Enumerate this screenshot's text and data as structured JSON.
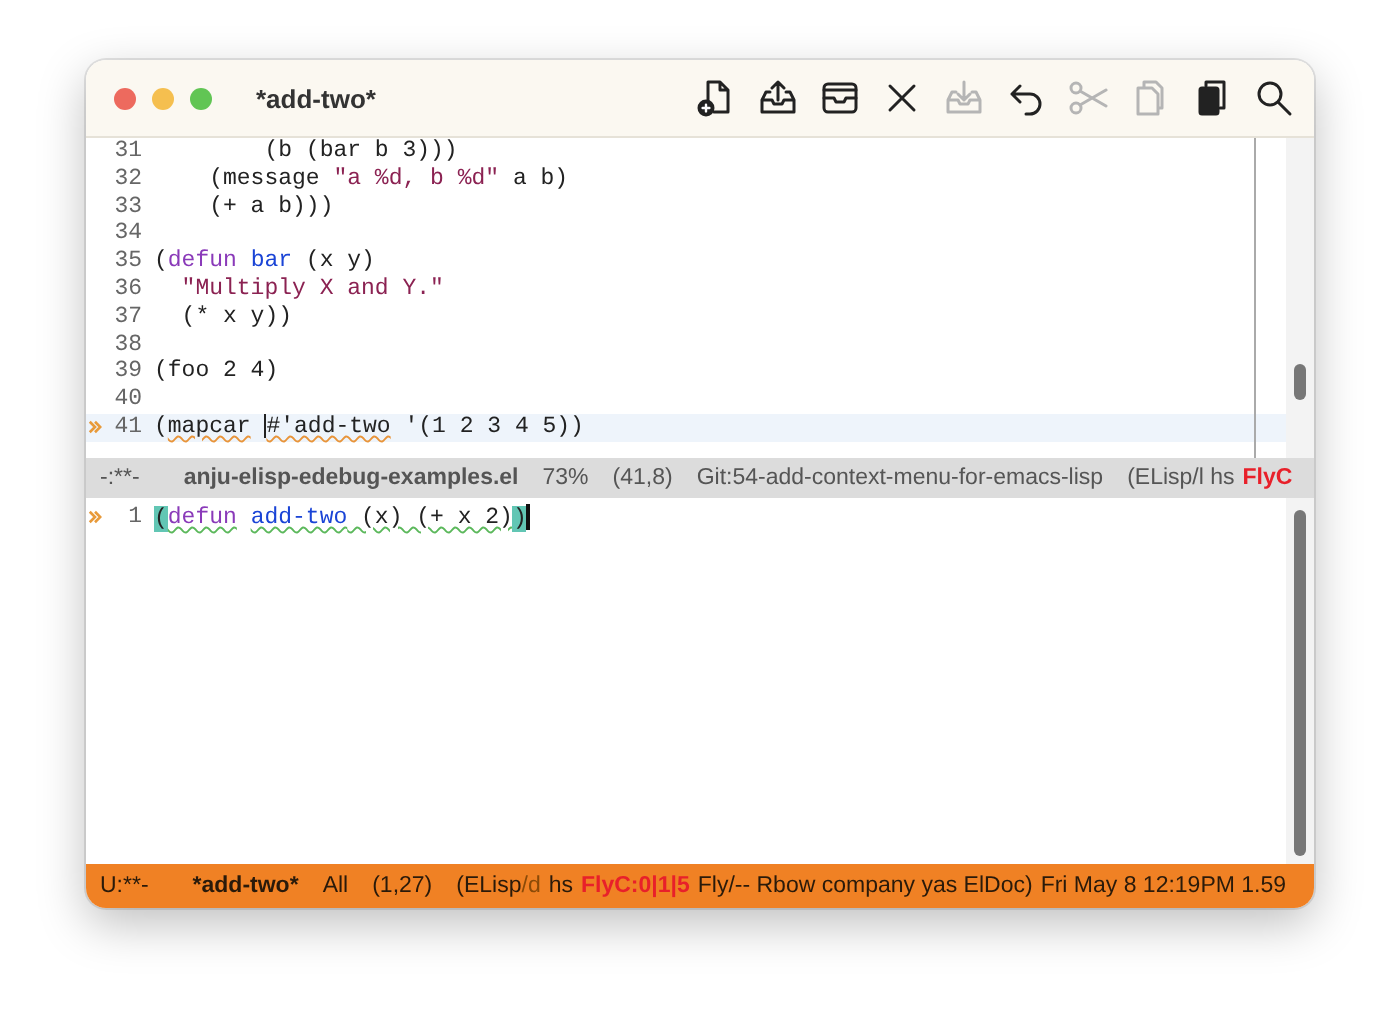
{
  "window": {
    "title": "*add-two*"
  },
  "toolbar": [
    {
      "kind": "new-file",
      "disabled": false
    },
    {
      "kind": "upload",
      "disabled": false
    },
    {
      "kind": "tray",
      "disabled": false
    },
    {
      "kind": "close",
      "disabled": false
    },
    {
      "kind": "download",
      "disabled": true
    },
    {
      "kind": "undo",
      "disabled": false
    },
    {
      "kind": "scissors",
      "disabled": true
    },
    {
      "kind": "copy",
      "disabled": true
    },
    {
      "kind": "paste",
      "disabled": false
    },
    {
      "kind": "search",
      "disabled": false
    }
  ],
  "panes": [
    {
      "active": false,
      "lines": [
        {
          "number": "31",
          "arrow": false,
          "highlighted": false,
          "segments": [
            {
              "kind": "plain",
              "text": "        (b (bar b 3)))"
            }
          ]
        },
        {
          "number": "32",
          "arrow": false,
          "highlighted": false,
          "segments": [
            {
              "kind": "plain",
              "text": "    (message "
            },
            {
              "kind": "string",
              "text": "\"a %d, b %d\""
            },
            {
              "kind": "plain",
              "text": " a b)"
            }
          ]
        },
        {
          "number": "33",
          "arrow": false,
          "highlighted": false,
          "segments": [
            {
              "kind": "plain",
              "text": "    (+ a b)))"
            }
          ]
        },
        {
          "number": "34",
          "arrow": false,
          "highlighted": false
        },
        {
          "number": "35",
          "arrow": false,
          "highlighted": false,
          "segments": [
            {
              "kind": "plain",
              "text": "("
            },
            {
              "kind": "keyword",
              "text": "defun"
            },
            {
              "kind": "space"
            },
            {
              "kind": "function",
              "text": "bar"
            },
            {
              "kind": "plain",
              "text": " (x y)"
            }
          ]
        },
        {
          "number": "36",
          "arrow": false,
          "highlighted": false,
          "segments": [
            {
              "kind": "string",
              "text": "  \"Multiply X and Y.\""
            }
          ]
        },
        {
          "number": "37",
          "arrow": false,
          "highlighted": false,
          "segments": [
            {
              "kind": "plain",
              "text": "  (* x y))"
            }
          ]
        },
        {
          "number": "38",
          "arrow": false,
          "highlighted": false
        },
        {
          "number": "39",
          "arrow": false,
          "highlighted": false,
          "segments": [
            {
              "kind": "plain",
              "text": "(foo 2 4)"
            }
          ]
        },
        {
          "number": "40",
          "arrow": false,
          "highlighted": false
        },
        {
          "number": "41",
          "arrow": true,
          "highlighted": true,
          "segments": [
            {
              "kind": "plain",
              "text": "("
            },
            {
              "kind": "warning",
              "text": "mapcar"
            },
            {
              "kind": "space"
            },
            {
              "kind": "cursor"
            },
            {
              "kind": "warning",
              "text": "#'add-two"
            },
            {
              "kind": "plain",
              "text": " '(1 2 3 4 5))"
            }
          ]
        }
      ],
      "mode_line": [
        {
          "kind": "plain",
          "text": "-:**-"
        },
        {
          "kind": "bold",
          "text": "anju-elisp-edebug-examples.el"
        },
        {
          "kind": "plain",
          "text": "73%"
        },
        {
          "kind": "plain",
          "text": "(41,8)"
        },
        {
          "kind": "plain",
          "text": "Git:54-add-context-menu-for-emacs-lisp"
        },
        {
          "kind": "plain",
          "text": "(ELisp/l hs"
        },
        {
          "kind": "error",
          "text": "FlyC"
        }
      ]
    },
    {
      "active": true,
      "lines": [
        {
          "number": "1",
          "arrow": true,
          "highlighted": false,
          "segments": [
            {
              "kind": "paren",
              "text": "("
            },
            {
              "kind": "keyword-ok",
              "text": "defun"
            },
            {
              "kind": "space-ok"
            },
            {
              "kind": "function-ok",
              "text": "add-two"
            },
            {
              "kind": "plain-ok",
              "text": " (x) (+ x 2)"
            },
            {
              "kind": "paren",
              "text": ")"
            },
            {
              "kind": "block-cursor"
            }
          ]
        }
      ],
      "mode_line": [
        {
          "kind": "plain",
          "text": "U:**-"
        },
        {
          "kind": "bold",
          "text": "*add-two*"
        },
        {
          "kind": "plain",
          "text": "All"
        },
        {
          "kind": "plain",
          "text": "(1,27)"
        },
        {
          "kind": "plain",
          "text": "(ELisp"
        },
        {
          "kind": "dim",
          "text": "/d"
        },
        {
          "kind": "tight",
          "text": "hs"
        },
        {
          "kind": "error",
          "text": "FlyC:0|1|5"
        },
        {
          "kind": "tight",
          "text": "Fly/-- Rbow company yas ElDoc)"
        },
        {
          "kind": "tight",
          "text": "Fri May  8 12:19PM 1.59"
        }
      ]
    }
  ]
}
